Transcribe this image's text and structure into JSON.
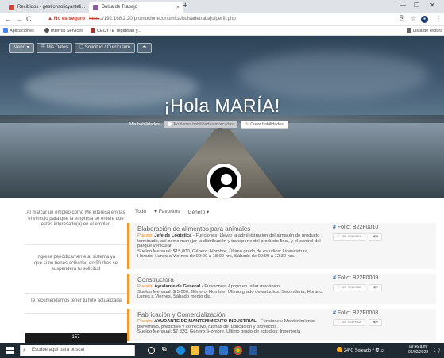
{
  "browser": {
    "tabs": [
      {
        "label": "Recibidos - gestionsolicyanteli...",
        "active": false
      },
      {
        "label": "Bolsa de Trabajo",
        "active": true
      }
    ],
    "url_warning": "No es seguro",
    "url_scheme": "https",
    "url_rest": "://192.168.2.20/promocioneconomica/bolsadetrabajo/perfil.php",
    "bookmarks": [
      "Aplicaciones",
      "Internal Services",
      "CECYTE Tepatitlán y..."
    ],
    "reading_list": "Lista de lectura"
  },
  "menu": {
    "items": [
      "Menú ▾",
      "Mis Datos",
      "Solicitud / Currículum",
      ""
    ]
  },
  "hero": {
    "greeting": "¡Hola MARÍA!",
    "skills_label": "Mis habilidades:",
    "skills_empty": "No tienes habilidades marcadas",
    "create_skills": "Crear habilidades"
  },
  "sidebar": {
    "info1": "Al marcar un empleo como Me interesa envías el vínculo para que la empresa se entere que estás interesado(a) en el empleo",
    "info2": "Ingresa periódicamente al sistema ya que si no tienes actividad en 90 días se suspenderá tu solicitud",
    "info3": "Te recomendamos tener tu foto actualizada",
    "count": "157"
  },
  "tabs": {
    "all": "Todo",
    "favorites": "Favoritos",
    "gender": "Género ▾"
  },
  "jobs": [
    {
      "title": "Elaboración de alimentos para animales",
      "puesto_label": "Puesto:",
      "puesto": "Jefe de Logística",
      "funciones": " - Funciones: Llevar la administración del almacén de producto terminado, así como manejar la distribución y transporte del producto final, y el control del parque vehicular",
      "sueldo": "Sueldo Mensual: $15,000, Género: Hombre, Último grado de estudios: Licenciatura, Horario: Lunes a Viernes de 09:00 a 18:00 hrs, Sábado de 09:00 a 12:30 hrs.",
      "folio": "Folio: B22F0010",
      "interest": "Me interesa",
      "share": "◀ ▾"
    },
    {
      "title": "Constructora",
      "puesto_label": "Puesto:",
      "puesto": "Ayudante de General",
      "funciones": " - Funciones: Apoyo en taller mecánico.",
      "sueldo": "Sueldo Mensual: $ 5,000, Género: Hombre, Último grado de estudios: Secundaria, Horario: Lunes a Viernes, Sábado medio día.",
      "folio": "Folio: B22F0009",
      "interest": "Me interesa",
      "share": "◀ ▾"
    },
    {
      "title": "Fabricación y Comercialización",
      "puesto_label": "Puesto:",
      "puesto": "AYUDANTE DE MANTENIMIENTO INDUSTRIAL",
      "funciones": " - Funciones: Mantenimiento preventivo, predictivo y correctivo, rutinas de lubricación y proyectos.",
      "sueldo": "Sueldo Mensual: $7,820, Género: Hombre, Último grado de estudios: Ingeniería",
      "folio": "Folio: B22F0008",
      "interest": "Me interesa",
      "share": "◀ ▾"
    }
  ],
  "taskbar": {
    "search_placeholder": "Escribe aquí para buscar",
    "weather": "24°C  Soleado",
    "tray_icons": "^ 🖫 ♫",
    "time": "09:46 a.m.",
    "date": "06/02/2022"
  },
  "colors": {
    "accent": "#f29b2c",
    "folio_hash": "#2a5d9a",
    "taskbar": "#1f2a33"
  }
}
